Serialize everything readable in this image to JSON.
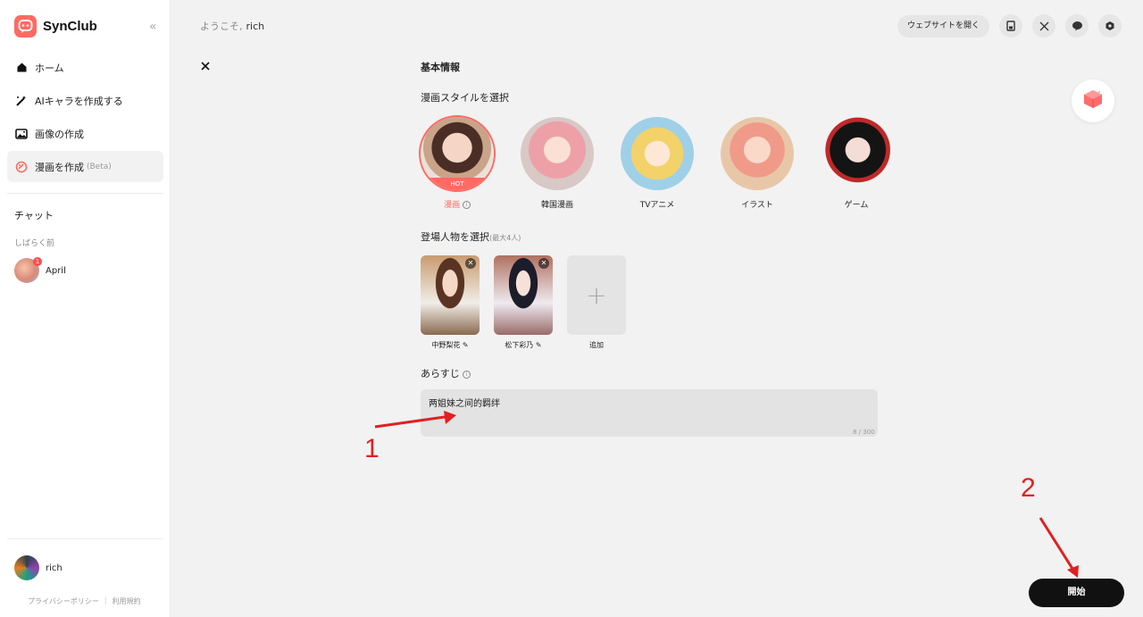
{
  "app": {
    "name": "SynClub"
  },
  "sidebar": {
    "items": [
      {
        "label": "ホーム"
      },
      {
        "label": "AIキャラを作成する"
      },
      {
        "label": "画像の作成"
      },
      {
        "label": "漫画を作成",
        "tag": "(Beta)"
      }
    ],
    "chat_heading": "チャット",
    "recent_heading": "しばらく前",
    "chats": [
      {
        "name": "April",
        "unread": "1"
      }
    ],
    "user": {
      "name": "rich"
    },
    "footer": {
      "privacy": "プライバシーポリシー",
      "terms": "利用規約"
    }
  },
  "header": {
    "welcome": "ようこそ,",
    "username": "rich",
    "open_site": "ウェブサイトを開く"
  },
  "form": {
    "section_title": "基本情報",
    "style_heading": "漫画スタイルを選択",
    "styles": [
      {
        "label": "漫画",
        "badge": "HOT",
        "selected": true
      },
      {
        "label": "韓国漫画"
      },
      {
        "label": "TVアニメ"
      },
      {
        "label": "イラスト"
      },
      {
        "label": "ゲーム"
      }
    ],
    "characters_heading": "登場人物を選択",
    "characters_hint": "(最大4人)",
    "characters": [
      {
        "name": "中野梨花"
      },
      {
        "name": "松下彩乃"
      }
    ],
    "add_label": "追加",
    "synopsis_heading": "あらすじ",
    "synopsis_value": "两姐妹之间的羁绊",
    "synopsis_count": "8 / 300",
    "start_button": "開始"
  },
  "annotations": {
    "one": "1",
    "two": "2"
  },
  "colors": {
    "accent": "#ff6b63",
    "arrow": "#e02020",
    "button": "#111111"
  }
}
